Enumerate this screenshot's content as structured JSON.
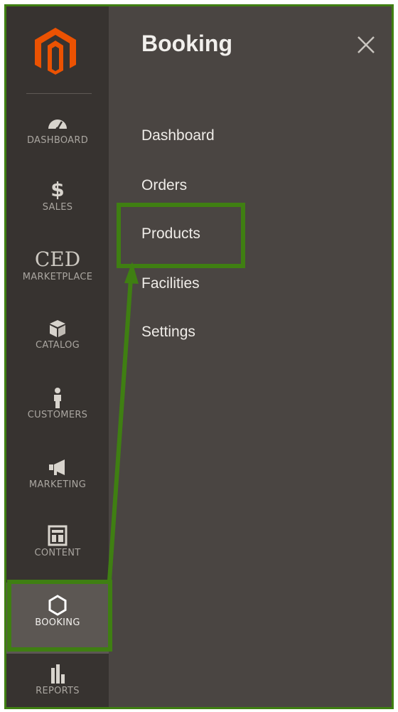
{
  "panel": {
    "title": "Booking",
    "items": [
      {
        "label": "Dashboard"
      },
      {
        "label": "Orders"
      },
      {
        "label": "Products"
      },
      {
        "label": "Facilities"
      },
      {
        "label": "Settings"
      }
    ]
  },
  "sidebar": {
    "items": [
      {
        "label": "DASHBOARD",
        "icon": "speedometer-icon"
      },
      {
        "label": "SALES",
        "icon": "dollar-icon"
      },
      {
        "label": "MARKETPLACE",
        "icon": "ced-logo-text",
        "logo_text": "CED"
      },
      {
        "label": "CATALOG",
        "icon": "cube-icon"
      },
      {
        "label": "CUSTOMERS",
        "icon": "person-icon"
      },
      {
        "label": "MARKETING",
        "icon": "megaphone-icon"
      },
      {
        "label": "CONTENT",
        "icon": "layout-icon"
      },
      {
        "label": "BOOKING",
        "icon": "hexagon-icon",
        "active": true
      },
      {
        "label": "REPORTS",
        "icon": "bar-chart-icon"
      }
    ]
  },
  "colors": {
    "sidebar_bg": "#373330",
    "panel_bg": "#4a4542",
    "active_bg": "#5c5753",
    "highlight": "#3f7f12",
    "brand_orange": "#eb5202"
  }
}
